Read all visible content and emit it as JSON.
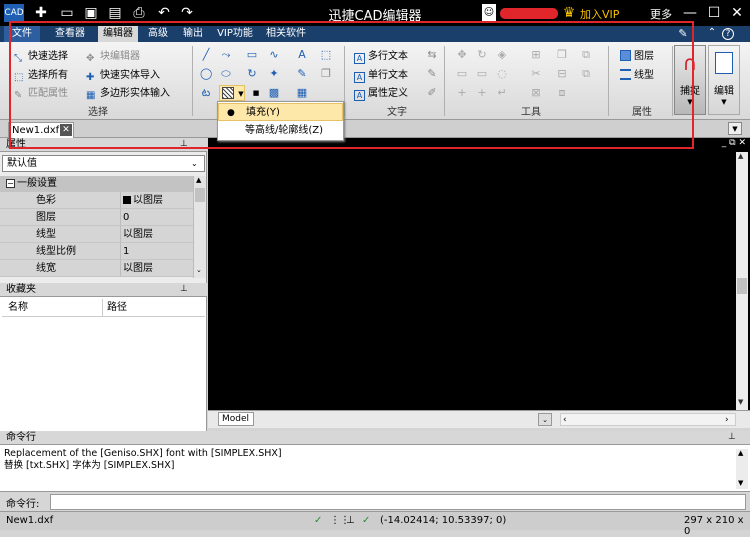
{
  "title": "迅捷CAD编辑器",
  "title_bar": {
    "vip_label": "加入VIP",
    "more_label": "更多"
  },
  "menu": [
    "文件",
    "查看器",
    "编辑器",
    "高级",
    "输出",
    "VIP功能",
    "相关软件"
  ],
  "ribbon": {
    "select_group": {
      "items": [
        "快速选择",
        "选择所有",
        "匹配属性"
      ],
      "label": "选择"
    },
    "block_group": {
      "items": [
        "块编辑器",
        "快速实体导入",
        "多边形实体输入"
      ]
    },
    "text_group": {
      "items": [
        "多行文本",
        "单行文本",
        "属性定义"
      ],
      "label": "文字"
    },
    "tools_group": {
      "label": "工具"
    },
    "props_group": {
      "items": [
        "图层",
        "线型"
      ],
      "label": "属性"
    },
    "snap_label": "捕捉",
    "edit_label": "编辑"
  },
  "hatch_dropdown": {
    "items": [
      "填充(Y)",
      "等高线/轮廓线(Z)"
    ]
  },
  "doc_tab": "New1.dxf",
  "properties_panel": {
    "title": "属性",
    "selector": "默认值",
    "section": "一般设置",
    "rows": [
      {
        "key": "色彩",
        "value": "以图层"
      },
      {
        "key": "图层",
        "value": "0"
      },
      {
        "key": "线型",
        "value": "以图层"
      },
      {
        "key": "线型比例",
        "value": "1"
      },
      {
        "key": "线宽",
        "value": "以图层"
      }
    ]
  },
  "favorites_panel": {
    "title": "收藏夹",
    "columns": [
      "名称",
      "路径"
    ]
  },
  "model_tab": "Model",
  "command": {
    "title": "命令行",
    "lines": [
      "Replacement of the [Geniso.SHX] font with [SIMPLEX.SHX]",
      "替换 [txt.SHX] 字体为 [SIMPLEX.SHX]"
    ],
    "prompt": "命令行:"
  },
  "status": {
    "file": "New1.dxf",
    "coords": "(-14.02414; 10.53397; 0)",
    "size": "297 x 210 x 0"
  },
  "colors": {
    "menubar": "#1a3f6b",
    "canvas": "#000000",
    "highlight": "#e0262b",
    "vip": "#f7c000"
  }
}
